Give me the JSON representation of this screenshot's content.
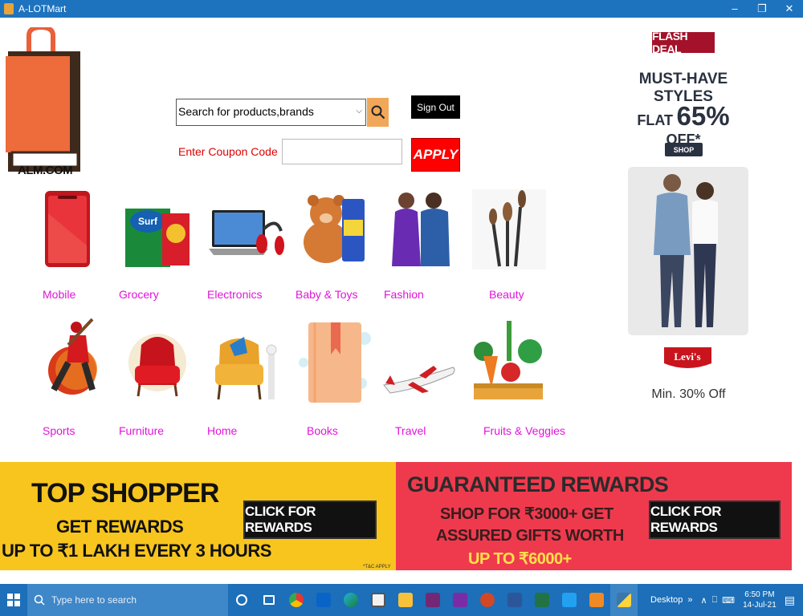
{
  "window": {
    "title": "A-LOTMart",
    "controls": [
      "–",
      "❐",
      "✕"
    ]
  },
  "logo": {
    "text": "ALM.COM"
  },
  "search": {
    "placeholder": "Search for products,brands"
  },
  "signout": {
    "label": "Sign Out"
  },
  "coupon": {
    "label": "Enter Coupon Code",
    "value": "",
    "apply_label": "APPLY"
  },
  "categories": [
    {
      "label": "Mobile"
    },
    {
      "label": "Grocery"
    },
    {
      "label": "Electronics"
    },
    {
      "label": "Baby & Toys"
    },
    {
      "label": "Fashion"
    },
    {
      "label": "Beauty"
    },
    {
      "label": "Sports"
    },
    {
      "label": "Furniture"
    },
    {
      "label": "Home"
    },
    {
      "label": "Books"
    },
    {
      "label": "Travel"
    },
    {
      "label": "Fruits & Veggies"
    }
  ],
  "flash_deal": {
    "badge": "FLASH DEAL",
    "headline": "MUST-HAVE STYLES",
    "flat_pre": "FLAT",
    "flat_pct": "65%",
    "flat_post": "OFF*",
    "shop_label": "SHOP",
    "brand": "Levi's",
    "offer": "Min. 30% Off"
  },
  "banners": {
    "left": {
      "title": "TOP SHOPPER",
      "line1": "GET REWARDS",
      "line2": "UP TO ₹1 LAKH EVERY 3 HOURS",
      "cta": "CLICK FOR REWARDS",
      "note": "*T&C APPLY"
    },
    "right": {
      "title": "GUARANTEED REWARDS",
      "line1": "SHOP FOR ₹3000+ GET",
      "line2": "ASSURED GIFTS WORTH",
      "line3": "UP TO ₹6000+",
      "cta": "CLICK FOR REWARDS"
    }
  },
  "taskbar": {
    "search_placeholder": "Type here to search",
    "desktop_label": "Desktop",
    "time": "6:50 PM",
    "date": "14-Jul-21",
    "pinned_icons": [
      "cortana-icon",
      "task-view-icon",
      "chrome-icon",
      "outlook-icon",
      "edge-icon",
      "store-icon",
      "file-explorer-icon",
      "powerapps-icon",
      "onenote-icon",
      "powerpoint-icon",
      "word-icon",
      "excel-icon",
      "vscode-icon",
      "sublime-icon",
      "python-icon"
    ]
  },
  "colors": {
    "titlebar": "#1e73be",
    "category_label": "#e014d9",
    "coupon_label": "#e00000",
    "apply_bg": "#ff0000",
    "banner_left": "#f7c51e",
    "banner_right": "#ef3a4e"
  }
}
